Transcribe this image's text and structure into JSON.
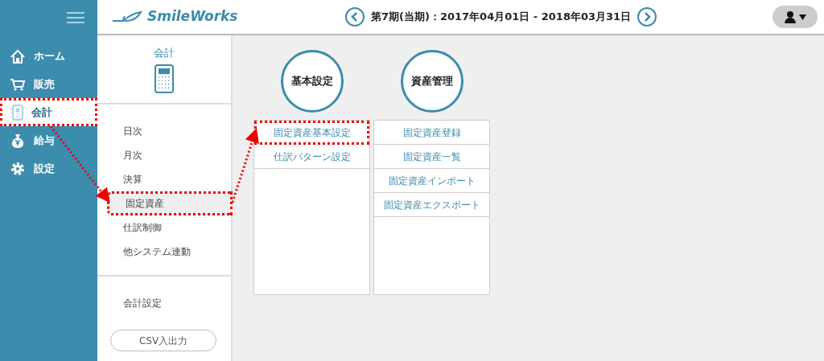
{
  "header": {
    "logo": "SmileWorks",
    "period": "第7期(当期)：2017年04月01日 - 2018年03月31日"
  },
  "sidebar": {
    "items": [
      {
        "label": "ホーム",
        "selected": false,
        "highlighted": false
      },
      {
        "label": "販売",
        "selected": false,
        "highlighted": false
      },
      {
        "label": "会計",
        "selected": true,
        "highlighted": true
      },
      {
        "label": "給与",
        "selected": false,
        "highlighted": false
      },
      {
        "label": "設定",
        "selected": false,
        "highlighted": false
      }
    ]
  },
  "submenu": {
    "title": "会計",
    "items": [
      {
        "label": "日次",
        "selected": false,
        "highlighted": false
      },
      {
        "label": "月次",
        "selected": false,
        "highlighted": false
      },
      {
        "label": "決算",
        "selected": false,
        "highlighted": false
      },
      {
        "label": "固定資産",
        "selected": true,
        "highlighted": true
      },
      {
        "label": "仕訳制御",
        "selected": false,
        "highlighted": false
      },
      {
        "label": "他システム連動",
        "selected": false,
        "highlighted": false
      }
    ],
    "settings_item": "会計設定",
    "csv_button": "CSV入出力"
  },
  "groups": [
    {
      "title": "基本設定",
      "items": [
        {
          "label": "固定資産基本設定",
          "highlighted": true
        },
        {
          "label": "仕訳パターン設定",
          "highlighted": false
        }
      ]
    },
    {
      "title": "資産管理",
      "items": [
        {
          "label": "固定資産登録",
          "highlighted": false
        },
        {
          "label": "固定資産一覧",
          "highlighted": false
        },
        {
          "label": "固定資産インポート",
          "highlighted": false
        },
        {
          "label": "固定資産エクスポート",
          "highlighted": false
        }
      ]
    }
  ]
}
